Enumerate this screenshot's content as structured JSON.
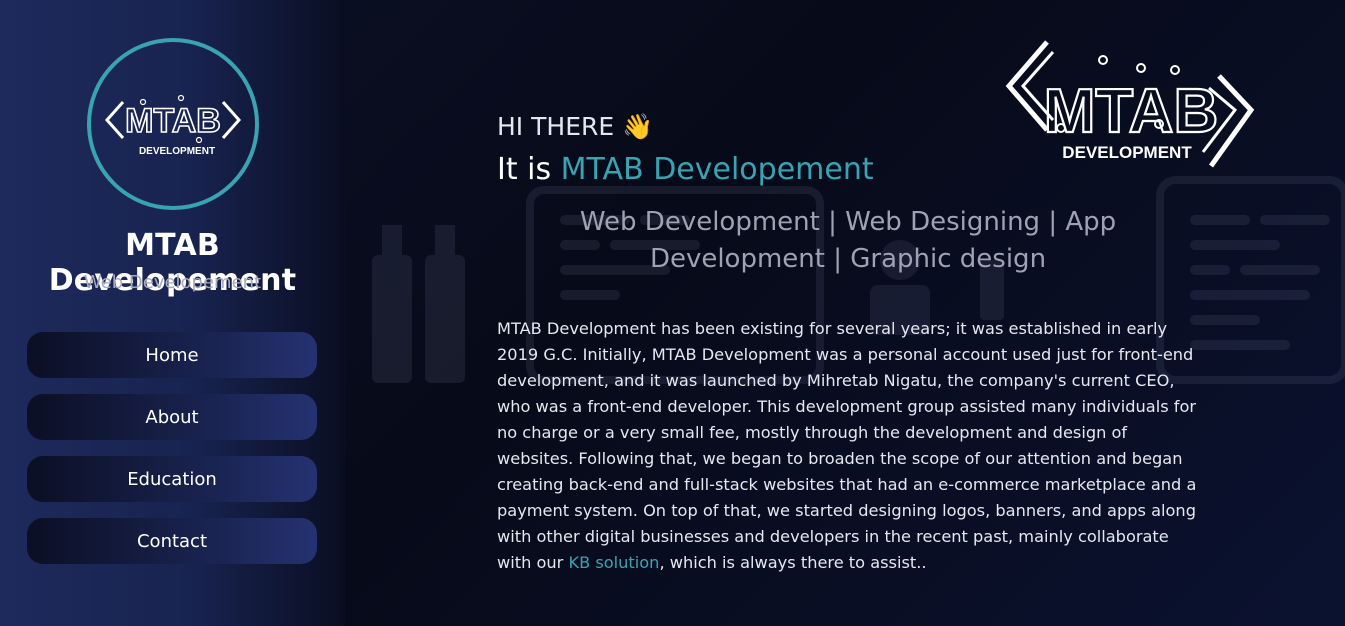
{
  "colors": {
    "accent": "#3aa3b2",
    "background": "#080b1c",
    "sidebar": "#1e2a5c",
    "text": "#e6e8f0",
    "muted": "#9ea2b3"
  },
  "sidebar": {
    "avatar_logo": {
      "mark": "MTAB",
      "caption": "DEVELOPMENT"
    },
    "title": "MTAB Developement",
    "subtitle": "Web Developement",
    "nav": [
      {
        "label": "Home"
      },
      {
        "label": "About"
      },
      {
        "label": "Education"
      },
      {
        "label": "Contact"
      }
    ]
  },
  "main": {
    "logo": {
      "mark": "MTAB",
      "caption": "DEVELOPMENT"
    },
    "greeting": "HI THERE",
    "greeting_emoji": "👋",
    "headline_prefix": "It is",
    "headline_accent": "MTAB Developement",
    "services": "Web Development | Web Designing | App Development | Graphic design",
    "about_text": "MTAB Development has been existing for several years; it was established in early 2019 G.C. Initially, MTAB Development was a personal account used just for front-end development, and it was launched by Mihretab Nigatu, the company's current CEO, who was a front-end developer. This development group assisted many individuals for no charge or a very small fee, mostly through the development and design of websites. Following that, we began to broaden the scope of our attention and began creating back-end and full-stack websites that had an e-commerce marketplace and a payment system. On top of that, we started designing logos, banners, and apps along with other digital businesses and developers in the recent past, mainly collaborate with our",
    "about_link": "KB solution",
    "about_suffix": ", which is always there to assist.."
  }
}
